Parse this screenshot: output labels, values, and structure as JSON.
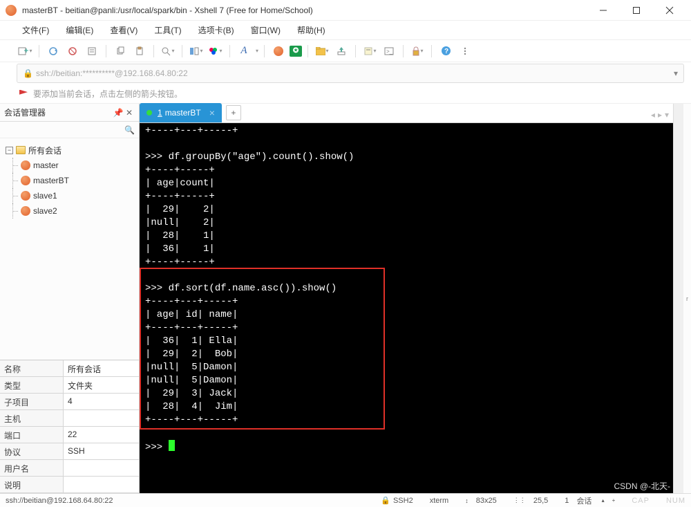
{
  "window": {
    "title": "masterBT - beitian@panli:/usr/local/spark/bin - Xshell 7 (Free for Home/School)"
  },
  "menu": {
    "file": "文件(F)",
    "edit": "编辑(E)",
    "view": "查看(V)",
    "tools": "工具(T)",
    "tabs": "选项卡(B)",
    "window": "窗口(W)",
    "help": "帮助(H)"
  },
  "addressbar": {
    "url": "ssh://beitian:**********@192.168.64.80:22"
  },
  "tipbar": {
    "text": "要添加当前会话，点击左侧的箭头按钮。"
  },
  "sidebar": {
    "title": "会话管理器",
    "root": "所有会话",
    "sessions": [
      "master",
      "masterBT",
      "slave1",
      "slave2"
    ]
  },
  "properties": {
    "labels": {
      "name": "名称",
      "type": "类型",
      "sub": "子项目",
      "host": "主机",
      "port": "端口",
      "proto": "协议",
      "user": "用户名",
      "desc": "说明"
    },
    "values": {
      "name": "所有会话",
      "type": "文件夹",
      "sub": "4",
      "host": "",
      "port": "22",
      "proto": "SSH",
      "user": "",
      "desc": ""
    }
  },
  "tab": {
    "index": "1",
    "label": "masterBT"
  },
  "terminal": {
    "lines": [
      "+----+---+-----+",
      "",
      ">>> df.groupBy(\"age\").count().show()",
      "+----+-----+",
      "| age|count|",
      "+----+-----+",
      "|  29|    2|",
      "|null|    2|",
      "|  28|    1|",
      "|  36|    1|",
      "+----+-----+",
      "",
      ">>> df.sort(df.name.asc()).show()",
      "+----+---+-----+",
      "| age| id| name|",
      "+----+---+-----+",
      "|  36|  1| Ella|",
      "|  29|  2|  Bob|",
      "|null|  5|Damon|",
      "|null|  5|Damon|",
      "|  29|  3| Jack|",
      "|  28|  4|  Jim|",
      "+----+---+-----+",
      "",
      ">>> "
    ]
  },
  "statusbar": {
    "conn": "ssh://beitian@192.168.64.80:22",
    "ssh": "SSH2",
    "term": "xterm",
    "size": "83x25",
    "pos": "25,5",
    "sessions_label": "会话",
    "sessions_count": "1",
    "cap": "CAP",
    "num": "NUM",
    "watermark": "CSDN @-北天-"
  }
}
